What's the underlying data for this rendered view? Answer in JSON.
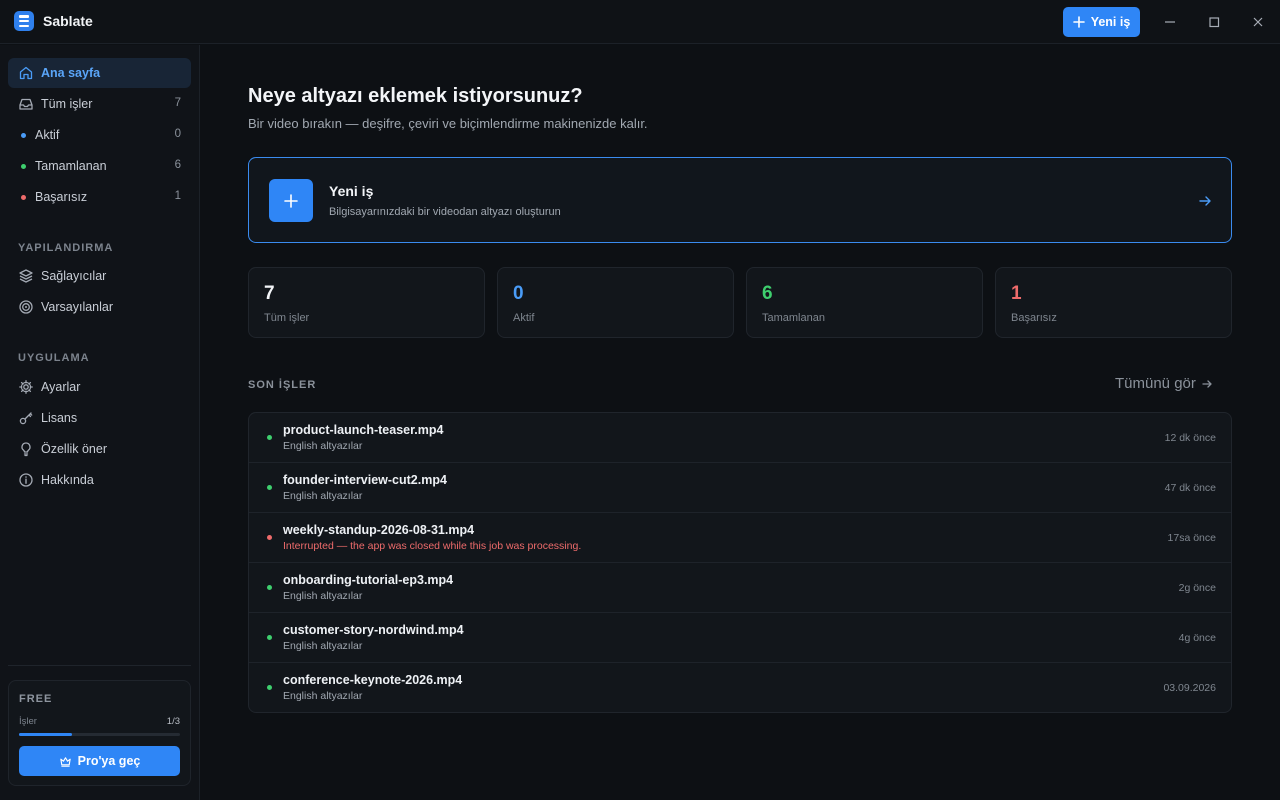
{
  "app": {
    "title": "Sablate",
    "new_job_label": "Yeni iş"
  },
  "sidebar": {
    "items": [
      {
        "label": "Ana sayfa",
        "icon": "home-icon",
        "active": true
      },
      {
        "label": "Tüm işler",
        "icon": "inbox-icon",
        "count": "7"
      },
      {
        "label": "Aktif",
        "dot": "#4a9cf7",
        "count": "0"
      },
      {
        "label": "Tamamlanan",
        "dot": "#3ecf6e",
        "count": "6"
      },
      {
        "label": "Başarısız",
        "dot": "#ee6b6b",
        "count": "1"
      }
    ],
    "config_title": "YAPILANDIRMA",
    "config_items": [
      {
        "label": "Sağlayıcılar",
        "icon": "layers-icon"
      },
      {
        "label": "Varsayılanlar",
        "icon": "target-icon"
      }
    ],
    "app_title": "UYGULAMA",
    "app_items": [
      {
        "label": "Ayarlar",
        "icon": "gear-icon"
      },
      {
        "label": "Lisans",
        "icon": "key-icon"
      },
      {
        "label": "Özellik öner",
        "icon": "lightbulb-icon"
      },
      {
        "label": "Hakkında",
        "icon": "info-icon"
      }
    ],
    "plan": {
      "name": "FREE",
      "usage_label": "İşler",
      "usage_count": "1/3",
      "usage_fraction": 0.33,
      "upgrade_label": "Pro'ya geç"
    }
  },
  "main": {
    "heading": "Neye altyazı eklemek istiyorsunuz?",
    "subheading": "Bir video bırakın — deşifre, çeviri ve biçimlendirme makinenizde kalır.",
    "hero": {
      "title": "Yeni iş",
      "description": "Bilgisayarınızdaki bir videodan altyazı oluşturun"
    },
    "stats": [
      {
        "value": "7",
        "label": "Tüm işler",
        "color": "#f3f5f8"
      },
      {
        "value": "0",
        "label": "Aktif",
        "color": "#4a9cf7"
      },
      {
        "value": "6",
        "label": "Tamamlanan",
        "color": "#3ecf6e"
      },
      {
        "value": "1",
        "label": "Başarısız",
        "color": "#ee6b6b"
      }
    ],
    "recent_title": "SON İŞLER",
    "see_all_label": "Tümünü gör",
    "jobs": [
      {
        "name": "product-launch-teaser.mp4",
        "subtitle": "English altyazılar",
        "time": "12 dk önce",
        "status": "completed"
      },
      {
        "name": "founder-interview-cut2.mp4",
        "subtitle": "English altyazılar",
        "time": "47 dk önce",
        "status": "completed"
      },
      {
        "name": "weekly-standup-2026-08-31.mp4",
        "subtitle": "Interrupted — the app was closed while this job was processing.",
        "time": "17sa önce",
        "status": "failed"
      },
      {
        "name": "onboarding-tutorial-ep3.mp4",
        "subtitle": "English altyazılar",
        "time": "2g önce",
        "status": "completed"
      },
      {
        "name": "customer-story-nordwind.mp4",
        "subtitle": "English altyazılar",
        "time": "4g önce",
        "status": "completed"
      },
      {
        "name": "conference-keynote-2026.mp4",
        "subtitle": "English altyazılar",
        "time": "03.09.2026",
        "status": "completed"
      }
    ]
  }
}
